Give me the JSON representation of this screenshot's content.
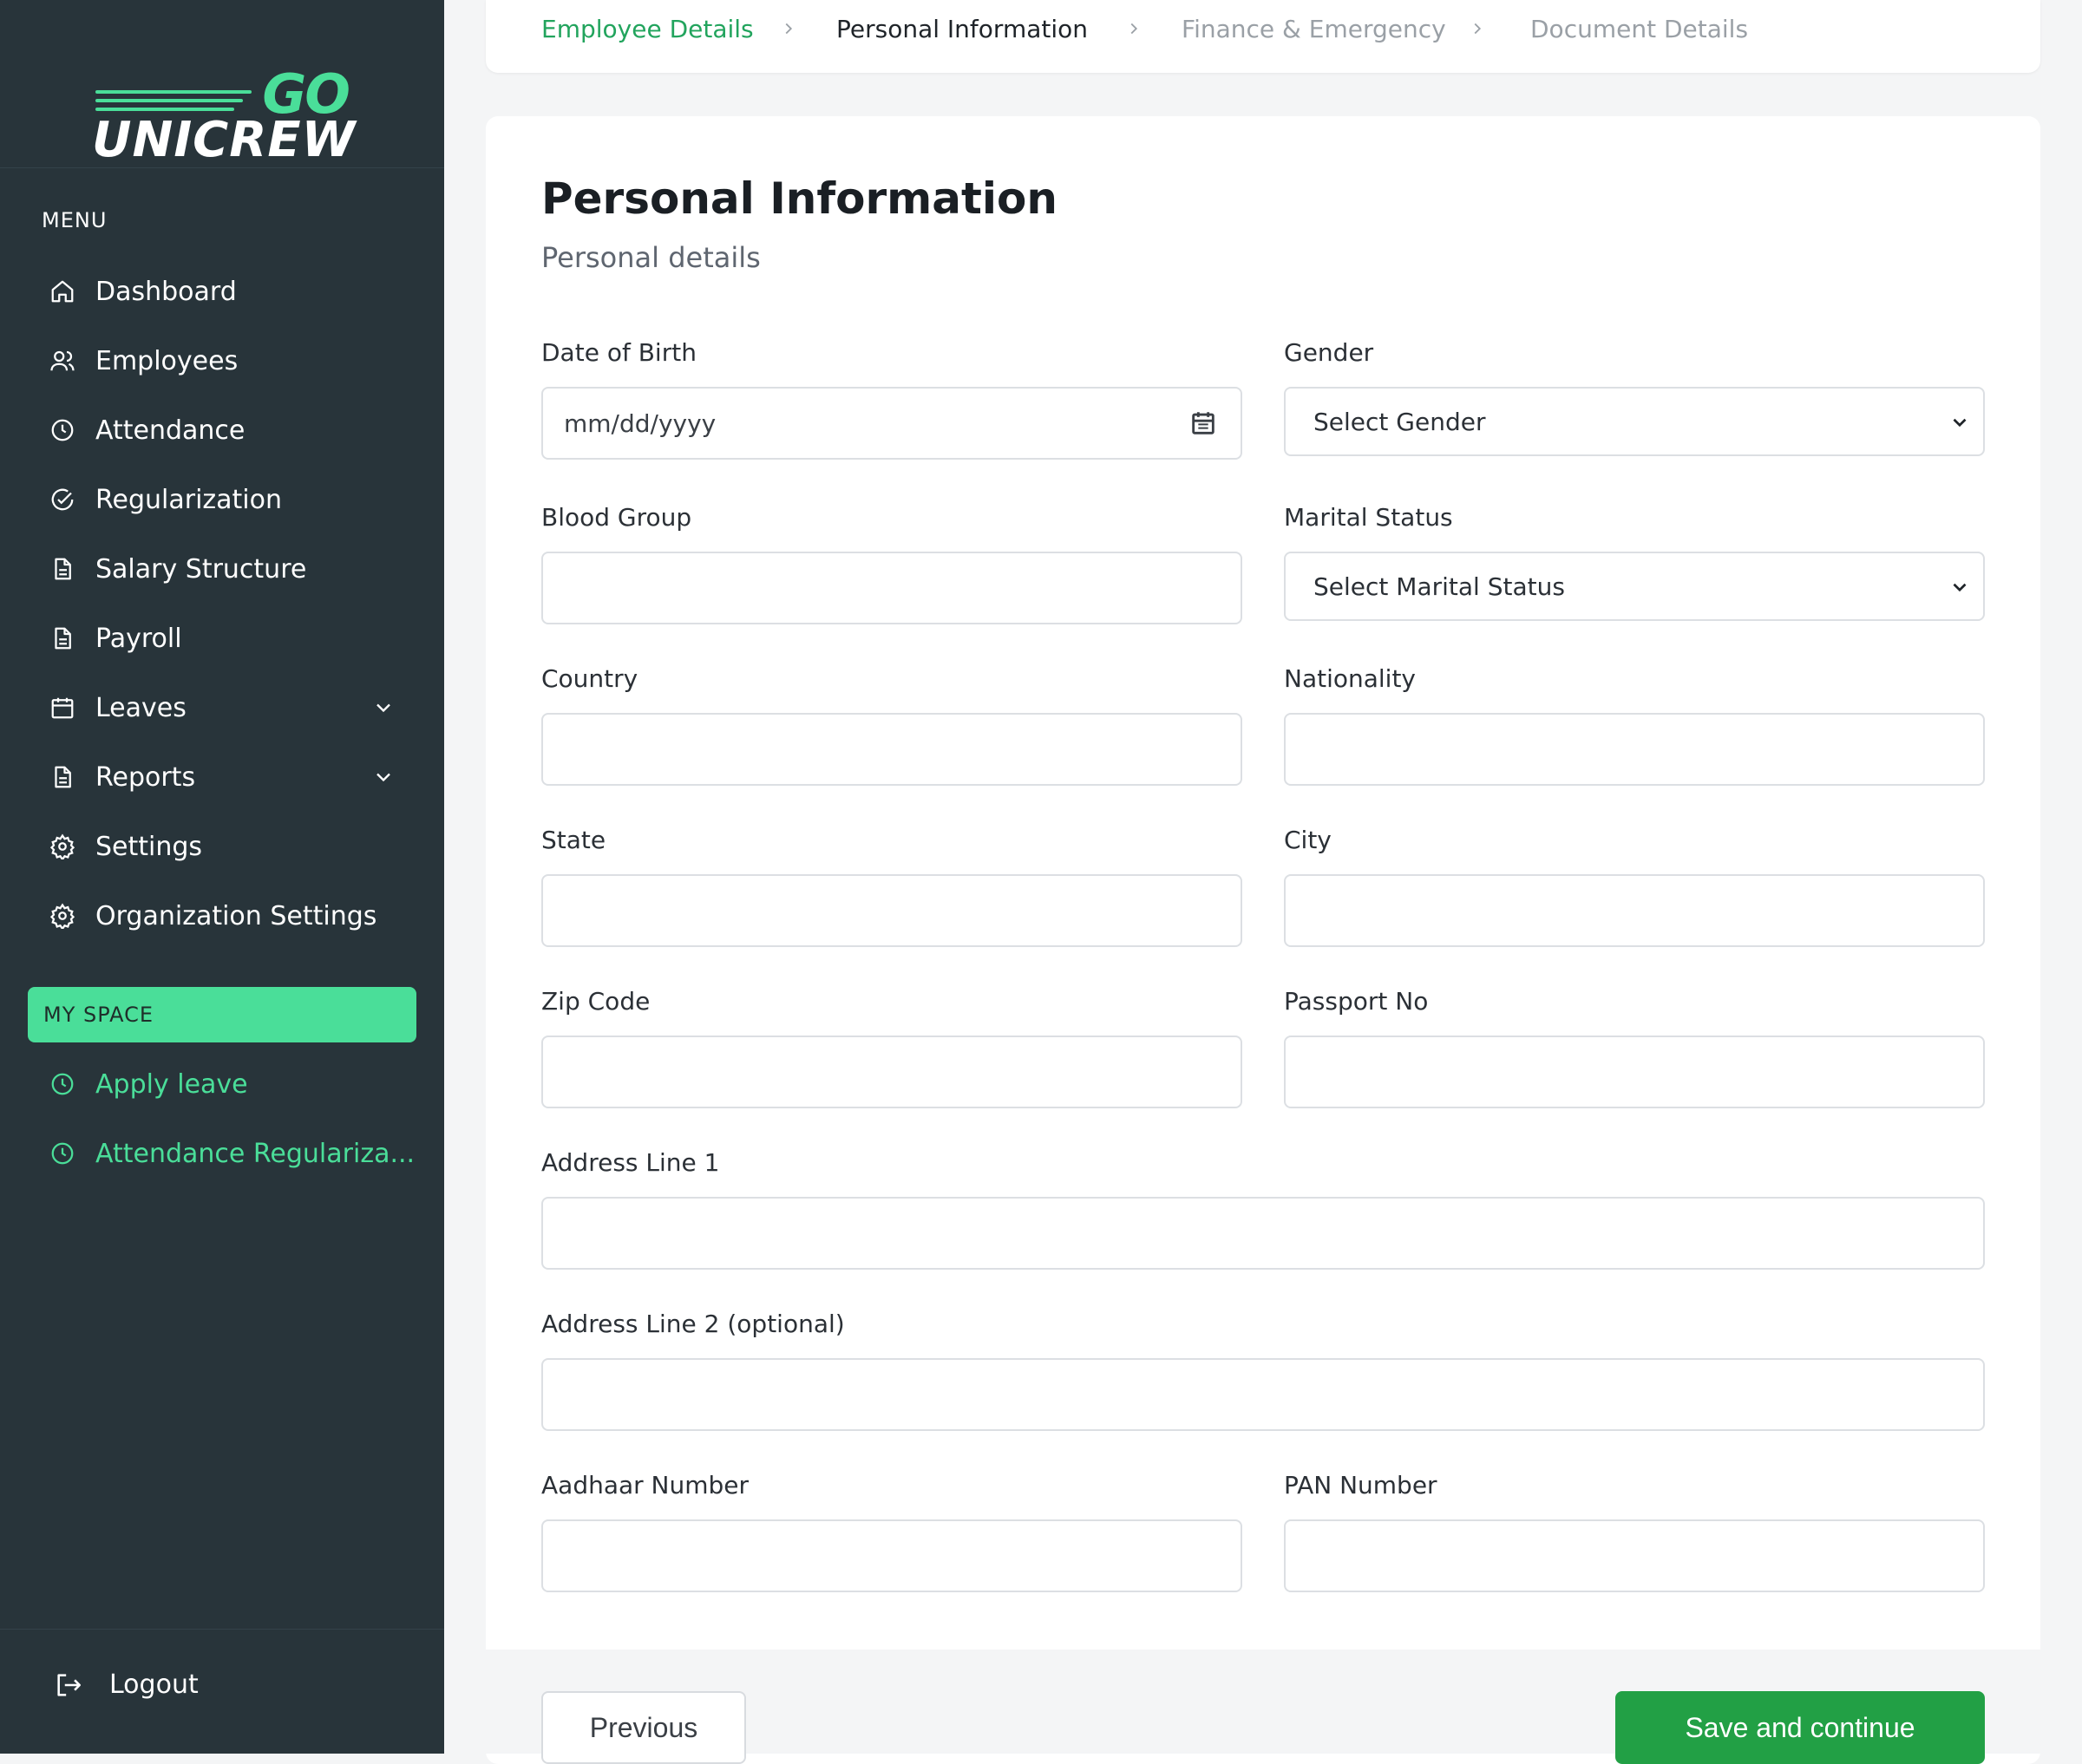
{
  "brand": {
    "logo_top": "GO",
    "logo_bottom": "UNICREW",
    "accent_color": "#4ade99",
    "primary_button_color": "#22a045",
    "sidebar_color": "#28343a"
  },
  "sidebar": {
    "menu_heading": "MENU",
    "items": [
      {
        "label": "Dashboard",
        "icon": "home-icon"
      },
      {
        "label": "Employees",
        "icon": "users-icon"
      },
      {
        "label": "Attendance",
        "icon": "clock-icon"
      },
      {
        "label": "Regularization",
        "icon": "check-circle-icon"
      },
      {
        "label": "Salary Structure",
        "icon": "document-icon"
      },
      {
        "label": "Payroll",
        "icon": "document-icon"
      },
      {
        "label": "Leaves",
        "icon": "calendar-icon",
        "expandable": true
      },
      {
        "label": "Reports",
        "icon": "document-icon",
        "expandable": true
      },
      {
        "label": "Settings",
        "icon": "gear-icon"
      },
      {
        "label": "Organization Settings",
        "icon": "gear-icon"
      }
    ],
    "my_space_heading": "MY SPACE",
    "my_space_items": [
      {
        "label": "Apply leave",
        "icon": "clock-icon"
      },
      {
        "label": "Attendance Regulariza...",
        "icon": "clock-icon"
      }
    ],
    "logout_label": "Logout"
  },
  "stepper": {
    "steps": [
      {
        "label": "Employee Details",
        "state": "done"
      },
      {
        "label": "Personal Information",
        "state": "active"
      },
      {
        "label": "Finance & Emergency",
        "state": "todo"
      },
      {
        "label": "Document Details",
        "state": "todo"
      }
    ]
  },
  "form": {
    "title": "Personal Information",
    "subtitle": "Personal details",
    "fields": {
      "dob": {
        "label": "Date of Birth",
        "placeholder": "mm/dd/yyyy",
        "value": ""
      },
      "gender": {
        "label": "Gender",
        "selected": "Select Gender"
      },
      "blood_group": {
        "label": "Blood Group",
        "value": ""
      },
      "marital_status": {
        "label": "Marital Status",
        "selected": "Select Marital Status"
      },
      "country": {
        "label": "Country",
        "value": ""
      },
      "nationality": {
        "label": "Nationality",
        "value": ""
      },
      "state": {
        "label": "State",
        "value": ""
      },
      "city": {
        "label": "City",
        "value": ""
      },
      "zip": {
        "label": "Zip Code",
        "value": ""
      },
      "passport": {
        "label": "Passport No",
        "value": ""
      },
      "address1": {
        "label": "Address Line 1",
        "value": ""
      },
      "address2": {
        "label": "Address Line 2 (optional)",
        "value": ""
      },
      "aadhaar": {
        "label": "Aadhaar Number",
        "value": ""
      },
      "pan": {
        "label": "PAN Number",
        "value": ""
      }
    }
  },
  "actions": {
    "previous_label": "Previous",
    "save_label": "Save and continue"
  }
}
